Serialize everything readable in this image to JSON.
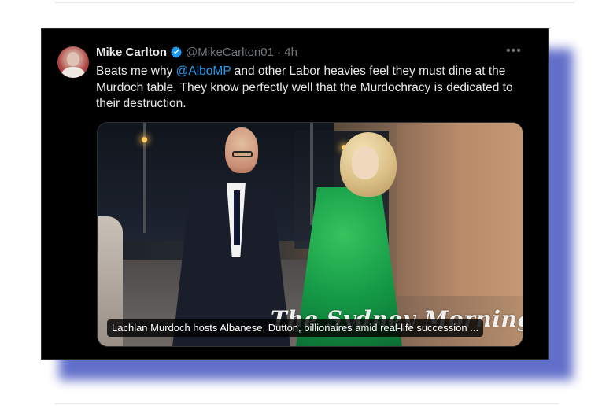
{
  "post": {
    "author_name": "Mike Carlton",
    "handle": "@MikeCarlton01",
    "separator": "·",
    "time": "4h",
    "more_label": "•••",
    "text_parts": {
      "before_mention": "Beats me why ",
      "mention": "@AlboMP",
      "after_mention": " and other Labor heavies feel they must dine at the Murdoch table.  They know perfectly well that the Murdochracy is dedicated to their destruction."
    }
  },
  "media": {
    "watermark": "The Sydney Morning Herald",
    "caption": "Lachlan Murdoch hosts Albanese, Dutton, billionaires amid real-life succession ..."
  },
  "colors": {
    "frame_bg": "#000000",
    "accent": "#1d9bf0",
    "text": "#e7e9ea",
    "muted": "#71767b",
    "shadow": "#5a68c7"
  }
}
